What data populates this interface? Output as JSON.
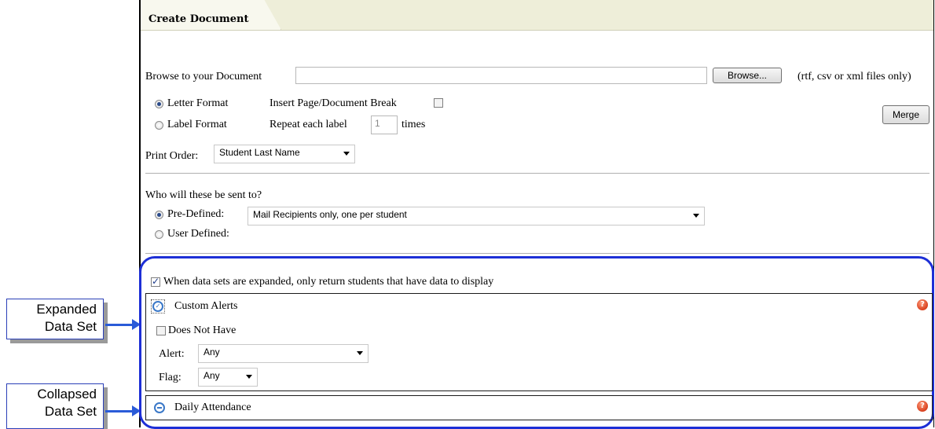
{
  "tab": {
    "title": "Create Document"
  },
  "browse": {
    "label": "Browse to your Document",
    "value": "",
    "button": "Browse...",
    "hint": "(rtf, csv or xml files only)"
  },
  "format": {
    "letter": "Letter Format",
    "label": "Label Format",
    "selected": "letter",
    "insert_break": "Insert Page/Document Break",
    "repeat_label": "Repeat each label",
    "repeat_value": "1",
    "times": "times",
    "merge": "Merge"
  },
  "print_order": {
    "label": "Print Order:",
    "value": "Student Last Name"
  },
  "recipients": {
    "question": "Who will these be sent to?",
    "predefined_label": "Pre-Defined:",
    "predefined_value": "Mail Recipients only, one per student",
    "user_defined": "User Defined:"
  },
  "datasets": {
    "only_return": "When data sets are expanded, only return students that have data to display",
    "custom_alerts": {
      "title": "Custom Alerts",
      "does_not_have": "Does Not Have",
      "alert_label": "Alert:",
      "alert_value": "Any",
      "flag_label": "Flag:",
      "flag_value": "Any"
    },
    "daily_attendance": {
      "title": "Daily Attendance"
    }
  },
  "callouts": {
    "expanded_line1": "Expanded",
    "expanded_line2": "Data Set",
    "collapsed_line1": "Collapsed",
    "collapsed_line2": "Data Set"
  },
  "colors": {
    "accent": "#1d2fd6",
    "tab_bg": "#eeeed9",
    "help": "#d8401e"
  },
  "icons": [
    "help-icon",
    "expand-icon",
    "collapse-icon"
  ]
}
